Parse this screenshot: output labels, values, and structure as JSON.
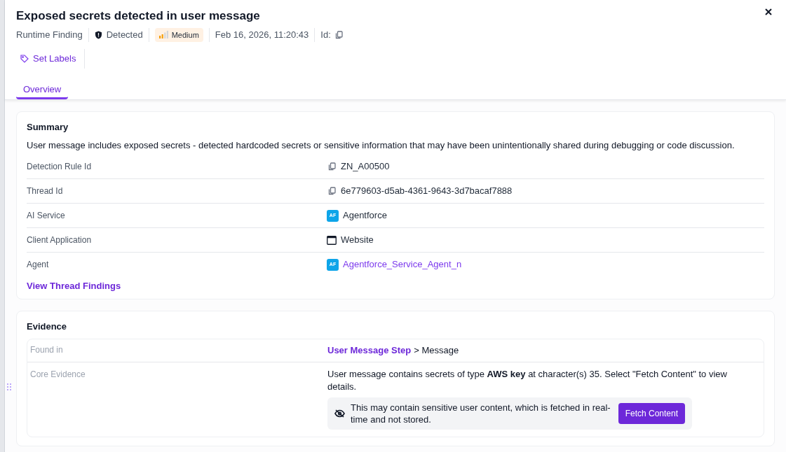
{
  "header": {
    "title": "Exposed secrets detected in user message",
    "meta": [
      {
        "kind": "text",
        "text": "Runtime Finding"
      },
      {
        "kind": "status",
        "text": "Detected"
      },
      {
        "kind": "severity",
        "text": "Medium"
      },
      {
        "kind": "text",
        "text": "Feb 16, 2026, 11:20:43"
      },
      {
        "kind": "id",
        "text": "Id:"
      }
    ],
    "labels_button": "Set Labels"
  },
  "tabs": [
    {
      "label": "Overview",
      "selected": true
    }
  ],
  "summary": {
    "title": "Summary",
    "description": "User message includes exposed secrets - detected hardcoded secrets or sensitive information that may have been unintentionally shared during debugging or code discussion.",
    "rows": [
      {
        "label": "Detection Rule Id",
        "value": "ZN_A00500",
        "kind": "copy",
        "link": false
      },
      {
        "label": "Thread Id",
        "value": "6e779603-d5ab-4361-9643-3d7bacaf7888",
        "kind": "copy",
        "link": false
      },
      {
        "label": "AI Service",
        "value": "Agentforce",
        "kind": "badge",
        "badge": "AF",
        "link": false
      },
      {
        "label": "Client Application",
        "value": "Website",
        "kind": "window",
        "link": false
      },
      {
        "label": "Agent",
        "value": "Agentforce_Service_Agent_n",
        "kind": "badge",
        "badge": "AF",
        "link": true
      }
    ],
    "link": "View Thread Findings"
  },
  "evidence": {
    "title": "Evidence",
    "rows": [
      {
        "kind": "path",
        "label": "Found in",
        "link": "User Message Step",
        "suffix": "> Message"
      },
      {
        "kind": "core",
        "label": "Core Evidence",
        "text": "User message contains secrets of type **AWS key** at character(s) 35. Select \"Fetch Content\" to view details.",
        "notice": "This may contain sensitive user content, which is fetched in real-time and not stored.",
        "button": "Fetch Content"
      }
    ]
  }
}
